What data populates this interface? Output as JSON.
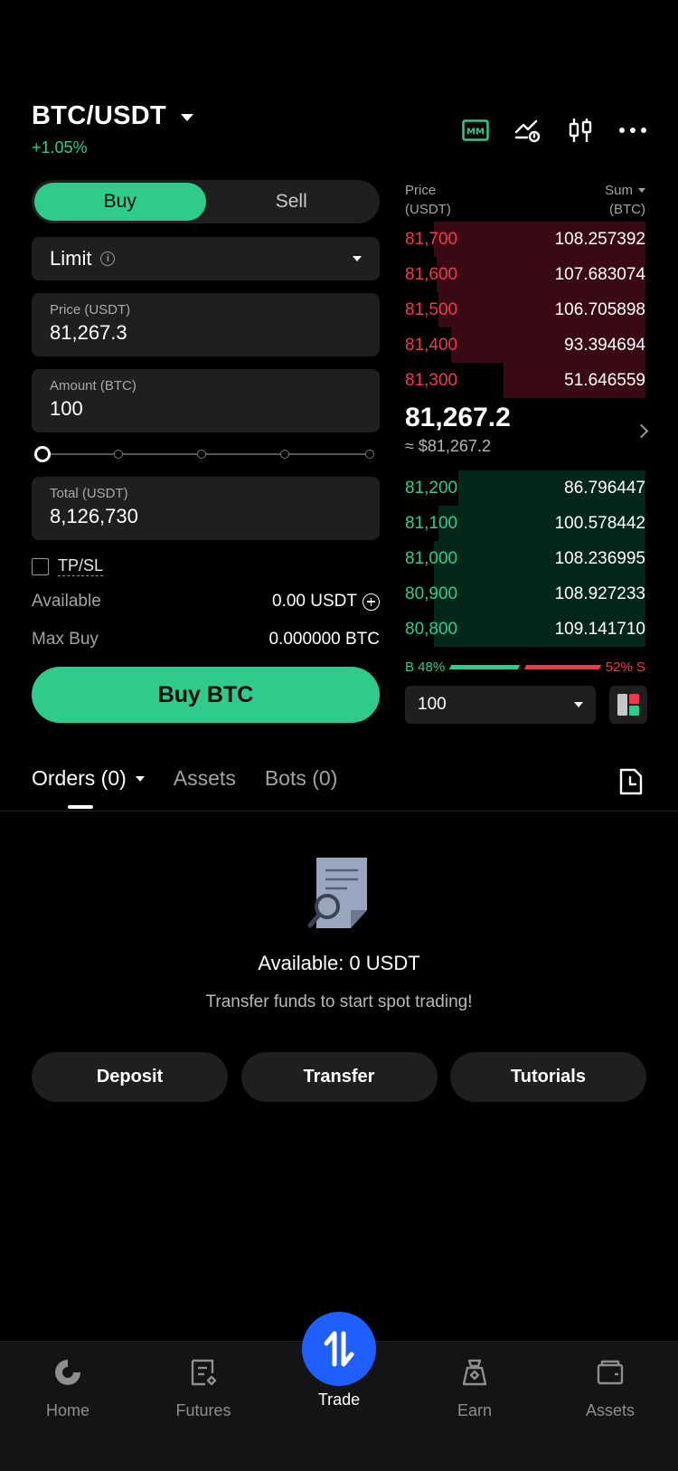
{
  "header": {
    "pair": "BTC/USDT",
    "change": "+1.05%",
    "icons": [
      "mm-icon",
      "price-alert-icon",
      "candlestick-icon",
      "more-icon"
    ],
    "mm_label": "MM"
  },
  "form": {
    "tabs": [
      "Buy",
      "Sell"
    ],
    "active_tab": "Buy",
    "order_type": "Limit",
    "price_label": "Price (USDT)",
    "price_value": "81,267.3",
    "amount_label": "Amount (BTC)",
    "amount_value": "100",
    "total_label": "Total (USDT)",
    "total_value": "8,126,730",
    "tpsl_label": "TP/SL",
    "available_label": "Available",
    "available_value": "0.00 USDT",
    "maxbuy_label": "Max Buy",
    "maxbuy_value": "0.000000 BTC",
    "submit_label": "Buy BTC",
    "slider_percent": 0
  },
  "orderbook": {
    "price_header_1": "Price",
    "price_header_2": "(USDT)",
    "sum_header_1": "Sum",
    "sum_header_2": "(BTC)",
    "asks": [
      {
        "price": "81,700",
        "sum": "108.257392",
        "depth": 0.88
      },
      {
        "price": "81,600",
        "sum": "107.683074",
        "depth": 0.87
      },
      {
        "price": "81,500",
        "sum": "106.705898",
        "depth": 0.86
      },
      {
        "price": "81,400",
        "sum": "93.394694",
        "depth": 0.81
      },
      {
        "price": "81,300",
        "sum": "51.646559",
        "depth": 0.59
      }
    ],
    "mid_price": "81,267.2",
    "mid_usd": "≈ $81,267.2",
    "bids": [
      {
        "price": "81,200",
        "sum": "86.796447",
        "depth": 0.78
      },
      {
        "price": "81,100",
        "sum": "100.578442",
        "depth": 0.86
      },
      {
        "price": "81,000",
        "sum": "108.236995",
        "depth": 0.88
      },
      {
        "price": "80,900",
        "sum": "108.927233",
        "depth": 0.88
      },
      {
        "price": "80,800",
        "sum": "109.141710",
        "depth": 0.88
      }
    ],
    "buy_ratio_label": "B 48%",
    "sell_ratio_label": "52% S",
    "buy_ratio": 48,
    "sell_ratio": 52,
    "depth_value": "100"
  },
  "orders": {
    "tabs": [
      "Orders (0)",
      "Assets",
      "Bots (0)"
    ],
    "available_text": "Available: 0 USDT",
    "hint": "Transfer funds to start spot trading!",
    "buttons": [
      "Deposit",
      "Transfer",
      "Tutorials"
    ]
  },
  "nav": {
    "items": [
      "Home",
      "Futures",
      "Trade",
      "Earn",
      "Assets"
    ],
    "active": "Trade"
  },
  "colors": {
    "green": "#2fcb8b",
    "red": "#f0394f",
    "blue": "#1f5fff"
  }
}
